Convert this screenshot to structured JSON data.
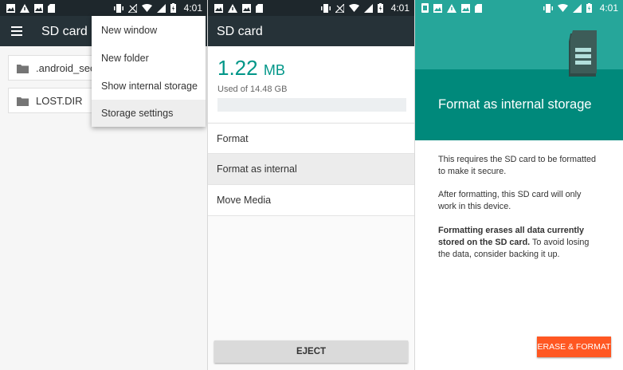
{
  "status_bar": {
    "time": "4:01"
  },
  "panel_files": {
    "title": "SD card",
    "items": [
      {
        "label": ".android_sec..."
      },
      {
        "label": "LOST.DIR"
      }
    ],
    "overflow_menu": [
      {
        "label": "New window"
      },
      {
        "label": "New folder"
      },
      {
        "label": "Show internal storage"
      },
      {
        "label": "Storage settings"
      }
    ]
  },
  "panel_storage": {
    "title": "SD card",
    "used_value": "1.22",
    "used_unit": "MB",
    "used_of": "Used of 14.48 GB",
    "options": [
      {
        "label": "Format"
      },
      {
        "label": "Format as internal"
      },
      {
        "label": "Move Media"
      }
    ],
    "eject_label": "EJECT"
  },
  "panel_format": {
    "title": "Format as internal storage",
    "para1": "This requires the SD card to be formatted to make it secure.",
    "para2": "After formatting, this SD card will only work in this device.",
    "para3_bold": "Formatting erases all data currently stored on the SD card.",
    "para3_rest": " To avoid losing the data, consider backing it up.",
    "erase_button": "ERASE & FORMAT"
  },
  "colors": {
    "toolbar": "#263238",
    "accent_teal": "#009688",
    "hero_teal": "#00897b",
    "hero_teal_light": "#26a69a",
    "erase_orange": "#ff5722"
  }
}
